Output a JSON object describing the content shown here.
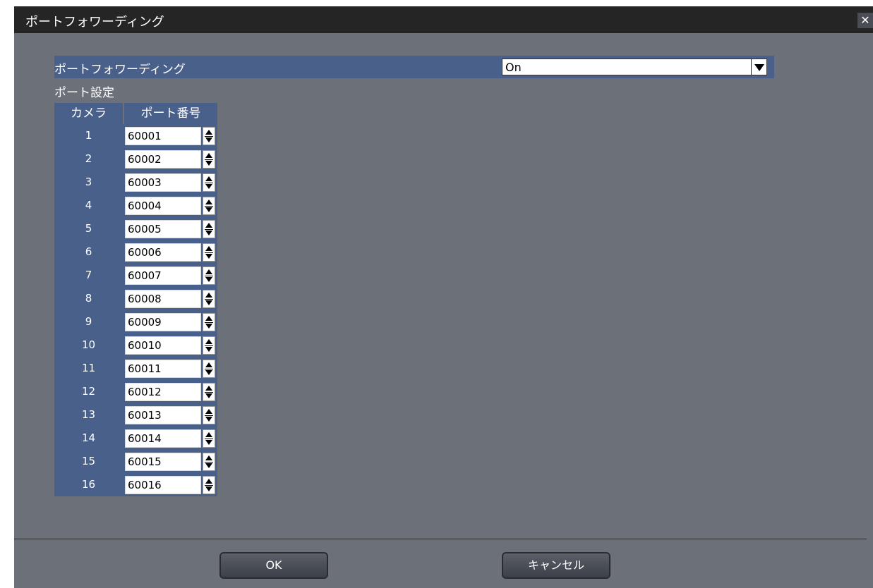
{
  "window": {
    "title": "ポートフォワーディング",
    "close_glyph": "✕"
  },
  "port_forwarding": {
    "label": "ポートフォワーディング",
    "value": "On"
  },
  "port_settings": {
    "label": "ポート設定",
    "headers": {
      "camera": "カメラ",
      "port": "ポート番号"
    },
    "rows": [
      {
        "camera": "1",
        "port": "60001"
      },
      {
        "camera": "2",
        "port": "60002"
      },
      {
        "camera": "3",
        "port": "60003"
      },
      {
        "camera": "4",
        "port": "60004"
      },
      {
        "camera": "5",
        "port": "60005"
      },
      {
        "camera": "6",
        "port": "60006"
      },
      {
        "camera": "7",
        "port": "60007"
      },
      {
        "camera": "8",
        "port": "60008"
      },
      {
        "camera": "9",
        "port": "60009"
      },
      {
        "camera": "10",
        "port": "60010"
      },
      {
        "camera": "11",
        "port": "60011"
      },
      {
        "camera": "12",
        "port": "60012"
      },
      {
        "camera": "13",
        "port": "60013"
      },
      {
        "camera": "14",
        "port": "60014"
      },
      {
        "camera": "15",
        "port": "60015"
      },
      {
        "camera": "16",
        "port": "60016"
      }
    ]
  },
  "buttons": {
    "ok": "OK",
    "cancel": "キャンセル"
  },
  "colors": {
    "background": "#6b7079",
    "titlebar": "#252525",
    "cell": "#49608a"
  }
}
